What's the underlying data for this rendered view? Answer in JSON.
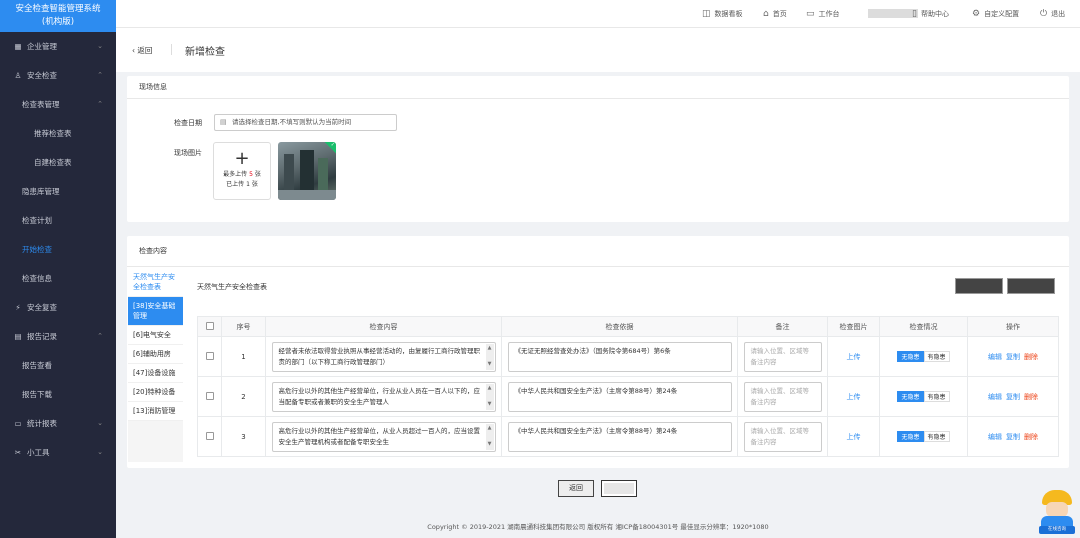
{
  "app": {
    "title_line1": "安全检查智能管理系统",
    "title_line2": "(机构版)"
  },
  "sidebar": {
    "items": [
      {
        "label": "企业管理",
        "icon": "building-icon"
      },
      {
        "label": "安全检查",
        "icon": "inspection-icon"
      },
      {
        "label": "检查表管理"
      },
      {
        "label": "推荐检查表"
      },
      {
        "label": "自建检查表"
      },
      {
        "label": "隐患库管理"
      },
      {
        "label": "检查计划"
      },
      {
        "label": "开始检查"
      },
      {
        "label": "检查信息"
      },
      {
        "label": "安全复查",
        "icon": "recheck-icon"
      },
      {
        "label": "报告记录",
        "icon": "report-icon"
      },
      {
        "label": "报告查看"
      },
      {
        "label": "报告下载"
      },
      {
        "label": "统计报表",
        "icon": "stats-icon"
      },
      {
        "label": "小工具",
        "icon": "tools-icon"
      }
    ]
  },
  "topbar": {
    "dashboard": "数据看板",
    "home": "首页",
    "workbench": "工作台",
    "help": "帮助中心",
    "custom": "自定义配置",
    "logout": "退出"
  },
  "header": {
    "back": "返回",
    "title": "新增检查"
  },
  "site_info": {
    "section_title": "现场信息",
    "date_label": "检查日期",
    "date_placeholder": "请选择检查日期,不填写则默认为当前时间",
    "photo_label": "现场图片",
    "upload_pre": "最多上传",
    "upload_max": "5",
    "upload_unit1": "张",
    "uploaded_pre": "已上传",
    "uploaded_count": "1",
    "upload_unit2": "张"
  },
  "content": {
    "section_title": "检查内容",
    "categories": [
      "天然气生产安全检查表",
      "[38]安全基础管理",
      "[6]电气安全",
      "[6]辅助用房",
      "[47]设备设施",
      "[20]特种设备",
      "[13]消防管理"
    ],
    "table_title": "天然气生产安全检查表",
    "columns": [
      "序号",
      "检查内容",
      "检查依据",
      "备注",
      "检查图片",
      "检查情况",
      "操作"
    ],
    "rows": [
      {
        "no": "1",
        "content": "经营者未依法取得营业执照从事经营活动的，由复履行工商行政管理职责的部门（以下称工商行政管理部门）",
        "basis": "《无证无照经营查处办法》（国务院令第684号）第6条"
      },
      {
        "no": "2",
        "content": "高危行业以外的其他生产经营单位，行业从业人员在一百人以下的，应当配备专职或者兼职的安全生产管理人",
        "basis": "《中华人民共和国安全生产法》（主席令第88号）第24条"
      },
      {
        "no": "3",
        "content": "高危行业以外的其他生产经营单位，从业人员超过一百人的，应当设置安全生产管理机构或者配备专职安全生",
        "basis": "《中华人民共和国安全生产法》（主席令第88号）第24条"
      }
    ],
    "remark_placeholder": "请输入位置、区域等备注内容",
    "upload_link": "上传",
    "status_on": "无隐患",
    "status_off": "有隐患",
    "op_edit": "编辑",
    "op_copy": "复制",
    "op_delete": "删除"
  },
  "footer": {
    "back": "返回",
    "copyright": "Copyright © 2019-2021 湖南晨通科技集团有限公司 版权所有 湘ICP备18004301号 最佳显示分辨率：1920*1080",
    "mascot": "在线咨询"
  },
  "colors": {
    "sidebar": "#24283b",
    "accent": "#2d8cf0",
    "danger": "#ed4014"
  }
}
